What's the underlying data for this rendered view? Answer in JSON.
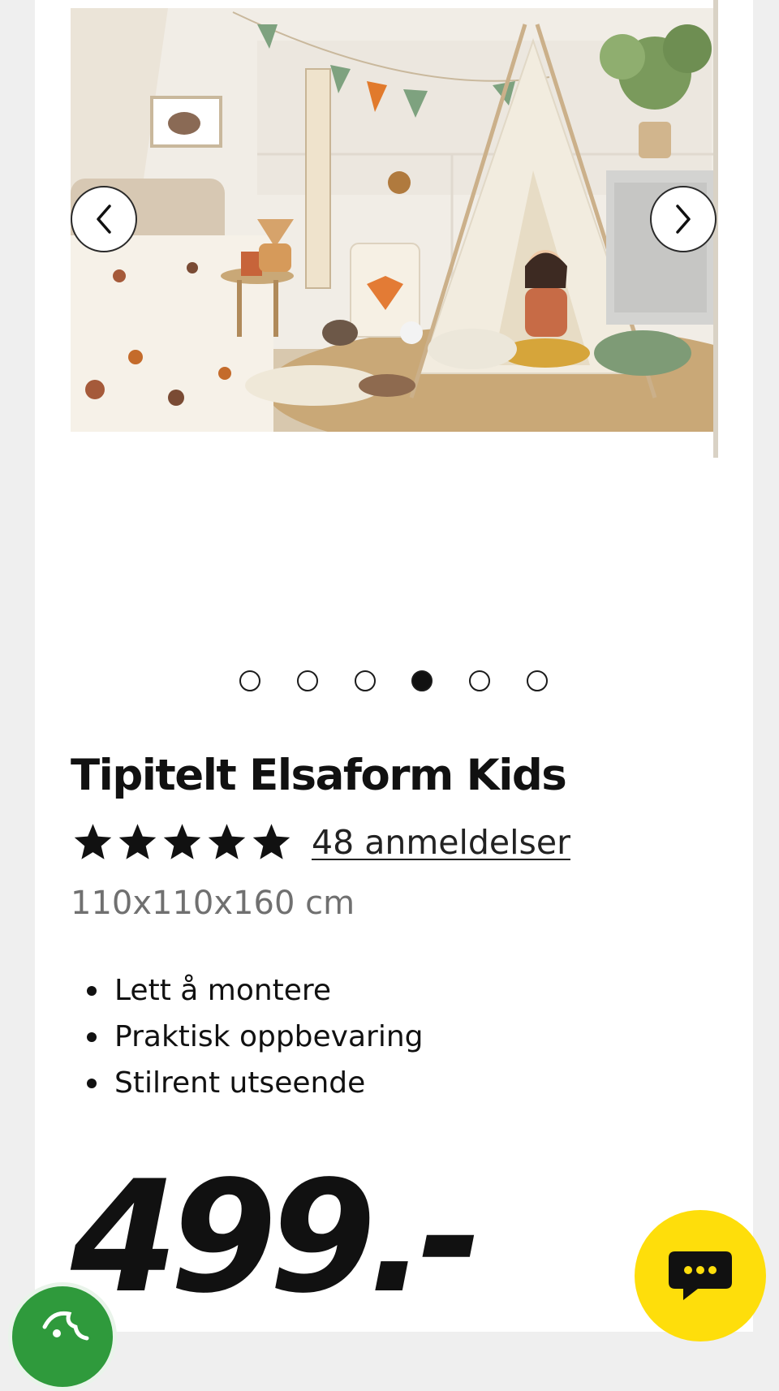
{
  "gallery": {
    "image_alt": "Tipitelt Elsaform Kids",
    "prev_icon": "chevron-left-icon",
    "next_icon": "chevron-right-icon",
    "dots_total": 6,
    "active_dot": 4
  },
  "product": {
    "title": "Tipitelt Elsaform Kids",
    "rating": 5,
    "reviews": "48 anmeldelser",
    "dimensions": "110x110x160 cm",
    "features": [
      "Lett å montere",
      "Praktisk oppbevaring",
      "Stilrent utseende"
    ],
    "price": "499.-"
  },
  "chat": {
    "icon": "chat-bubble-icon",
    "color": "#fede0b"
  },
  "cookie": {
    "icon": "cookie-icon",
    "color": "#2f9a3c"
  }
}
